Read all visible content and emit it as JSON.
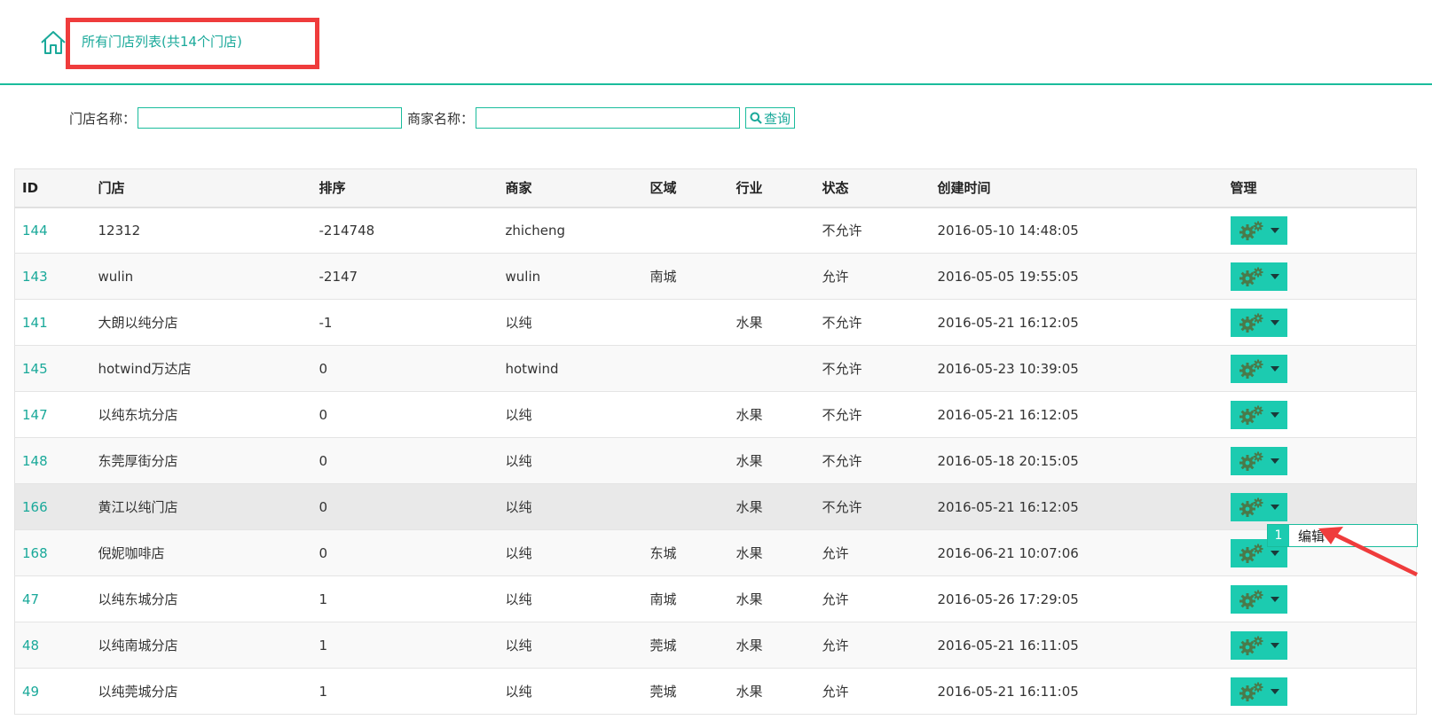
{
  "header": {
    "title": "所有门店列表(共14个门店)",
    "accent": "#1abc9c",
    "highlight": "#ef3c3c"
  },
  "search": {
    "store_label": "门店名称：",
    "merchant_label": "商家名称：",
    "store_value": "",
    "merchant_value": "",
    "button_label": "查询"
  },
  "table": {
    "columns": [
      "ID",
      "门店",
      "排序",
      "商家",
      "区域",
      "行业",
      "状态",
      "创建时间",
      "管理"
    ],
    "rows": [
      [
        "144",
        "12312",
        "-214748",
        "zhicheng",
        "",
        "",
        "不允许",
        "2016-05-10 14:48:05"
      ],
      [
        "143",
        "wulin",
        "-2147",
        "wulin",
        "南城",
        "",
        "允许",
        "2016-05-05 19:55:05"
      ],
      [
        "141",
        "大朗以纯分店",
        "-1",
        "以纯",
        "",
        "水果",
        "不允许",
        "2016-05-21 16:12:05"
      ],
      [
        "145",
        "hotwind万达店",
        "0",
        "hotwind",
        "",
        "",
        "不允许",
        "2016-05-23 10:39:05"
      ],
      [
        "147",
        "以纯东坑分店",
        "0",
        "以纯",
        "",
        "水果",
        "不允许",
        "2016-05-21 16:12:05"
      ],
      [
        "148",
        "东莞厚街分店",
        "0",
        "以纯",
        "",
        "水果",
        "不允许",
        "2016-05-18 20:15:05"
      ],
      [
        "166",
        "黄江以纯门店",
        "0",
        "以纯",
        "",
        "水果",
        "不允许",
        "2016-05-21 16:12:05"
      ],
      [
        "168",
        "倪妮咖啡店",
        "0",
        "以纯",
        "东城",
        "水果",
        "允许",
        "2016-06-21 10:07:06"
      ],
      [
        "47",
        "以纯东城分店",
        "1",
        "以纯",
        "南城",
        "水果",
        "允许",
        "2016-05-26 17:29:05"
      ],
      [
        "48",
        "以纯南城分店",
        "1",
        "以纯",
        "莞城",
        "水果",
        "允许",
        "2016-05-21 16:11:05"
      ],
      [
        "49",
        "以纯莞城分店",
        "1",
        "以纯",
        "莞城",
        "水果",
        "允许",
        "2016-05-21 16:11:05"
      ]
    ]
  },
  "dropdown": {
    "number": "1",
    "label": "编辑"
  },
  "icons": {
    "home": "home-icon",
    "search": "search-icon",
    "gear": "gear-icon",
    "caret": "caret-down-icon"
  }
}
